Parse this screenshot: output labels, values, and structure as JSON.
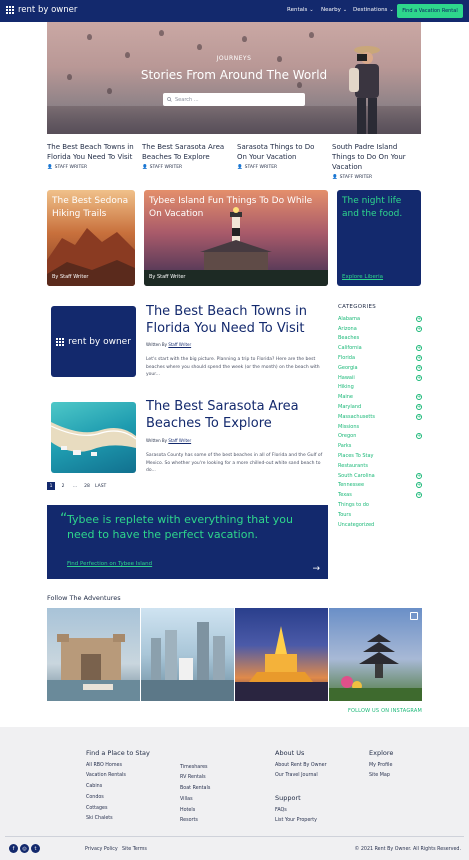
{
  "header": {
    "brand": "rent by owner",
    "nav": [
      {
        "label": "Rentals"
      },
      {
        "label": "Nearby"
      },
      {
        "label": "Destinations"
      }
    ],
    "cta": "Find a Vacation Rental",
    "colors": {
      "navy": "#13296d",
      "accent": "#2ed68c"
    }
  },
  "hero": {
    "kicker": "JOURNEYS",
    "title": "Stories From Around The World",
    "search_placeholder": "Search ..."
  },
  "featured": [
    {
      "title": "The Best Beach Towns in Florida You Need To Visit",
      "author": "STAFF WRITER"
    },
    {
      "title": "The Best Sarasota Area Beaches To Explore",
      "author": "STAFF WRITER"
    },
    {
      "title": "Sarasota Things to Do On Your Vacation",
      "author": "STAFF WRITER"
    },
    {
      "title": "South Padre Island Things to Do On Your Vacation",
      "author": "STAFF WRITER"
    }
  ],
  "cards": [
    {
      "title": "The Best Sedona Hiking Trails",
      "author": "By Staff Writer"
    },
    {
      "title": "Tybee Island Fun Things To Do While On Vacation",
      "author": "By Staff Writer"
    },
    {
      "title": "The night life and the food.",
      "link": "Explore Liberia"
    }
  ],
  "posts": [
    {
      "title": "The Best Beach Towns in Florida You Need To Visit",
      "by_prefix": "Written By",
      "author": "Staff Writer",
      "excerpt": "Let's start with the big picture. Planning a trip to Florida? Here are the best beaches where you should spend the week (or the month) on the beach with your...",
      "thumb_brand": "rent by owner"
    },
    {
      "title": "The Best Sarasota Area Beaches To Explore",
      "by_prefix": "Written By",
      "author": "Staff Writer",
      "excerpt": "Sarasota County has some of the best beaches in all of Florida and the Gulf of Mexico. So whether you're looking for a more chilled-out white sand beach to do..."
    }
  ],
  "pagination": {
    "pages": [
      "1",
      "2",
      "...",
      "28"
    ],
    "last": "LAST",
    "current": "1"
  },
  "categories": {
    "heading": "CATEGORIES",
    "items": [
      {
        "label": "Alabama",
        "expand": true
      },
      {
        "label": "Arizona",
        "expand": true
      },
      {
        "label": "Beaches",
        "expand": false
      },
      {
        "label": "California",
        "expand": true
      },
      {
        "label": "Florida",
        "expand": true
      },
      {
        "label": "Georgia",
        "expand": true
      },
      {
        "label": "Hawaii",
        "expand": true
      },
      {
        "label": "Hiking",
        "expand": false
      },
      {
        "label": "Maine",
        "expand": true
      },
      {
        "label": "Maryland",
        "expand": true
      },
      {
        "label": "Massachusetts",
        "expand": true
      },
      {
        "label": "Missions",
        "expand": false
      },
      {
        "label": "Oregon",
        "expand": true
      },
      {
        "label": "Parks",
        "expand": false
      },
      {
        "label": "Places To Stay",
        "expand": false
      },
      {
        "label": "Restaurants",
        "expand": false
      },
      {
        "label": "South Carolina",
        "expand": true
      },
      {
        "label": "Tennessee",
        "expand": true
      },
      {
        "label": "Texas",
        "expand": true
      },
      {
        "label": "Things to do",
        "expand": false
      },
      {
        "label": "Tours",
        "expand": false
      },
      {
        "label": "Uncategorized",
        "expand": false
      }
    ]
  },
  "quote": {
    "text": "Tybee is replete with everything that you need to have the perfect vacation.",
    "link": "Find Perfection on Tybee Island"
  },
  "instagram": {
    "heading": "Follow The Adventures",
    "cta": "FOLLOW US ON INSTAGRAM"
  },
  "footer": {
    "col1": {
      "heading": "Find a Place to Stay",
      "links": [
        "All RBO Homes",
        "Vacation Rentals",
        "Cabins",
        "Condos",
        "Cottages",
        "Ski Chalets"
      ]
    },
    "col2": {
      "links": [
        "Timeshares",
        "RV Rentals",
        "Boat Rentals",
        "Villas",
        "Hotels",
        "Resorts"
      ]
    },
    "col3": {
      "heading": "About Us",
      "links": [
        "About Rent By Owner",
        "Our Travel Journal"
      ]
    },
    "support": {
      "heading": "Support",
      "links": [
        "FAQs",
        "List Your Property"
      ]
    },
    "col4": {
      "heading": "Explore",
      "links": [
        "My Profile",
        "Site Map"
      ]
    },
    "legal": [
      "Privacy Policy",
      "Site Terms"
    ],
    "copyright": "© 2021 Rent By Owner. All Rights Reserved.",
    "social": [
      "facebook-icon",
      "instagram-icon",
      "twitter-icon"
    ]
  }
}
